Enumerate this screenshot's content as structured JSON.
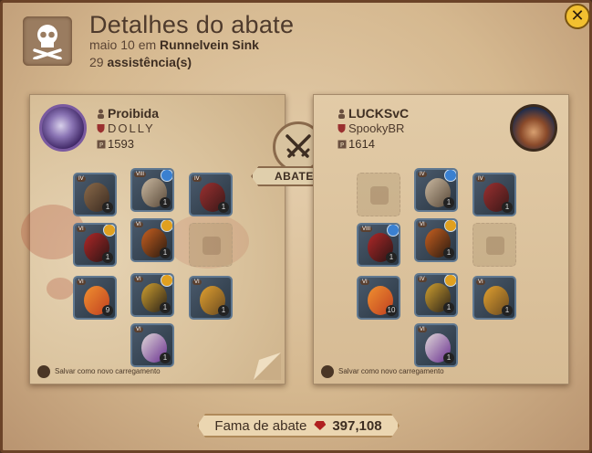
{
  "dialog": {
    "title": "Detalhes do abate",
    "date_text": "maio 10 em",
    "location": "Runnelvein Sink",
    "assist_count": "29",
    "assist_label": "assistência(s)"
  },
  "killer": {
    "name": "Proibida",
    "guild": "DOLLY",
    "ip": "1593",
    "equipment": [
      {
        "slot": "bag",
        "tier": "IV",
        "quality": "1",
        "badge": ""
      },
      {
        "slot": "helmet",
        "tier": "VIII",
        "quality": "1",
        "badge": "blue"
      },
      {
        "slot": "cape",
        "tier": "IV",
        "quality": "1",
        "badge": ""
      },
      {
        "slot": "weapon",
        "tier": "VI",
        "quality": "1",
        "badge": "gold"
      },
      {
        "slot": "armor",
        "tier": "VI",
        "quality": "1",
        "badge": "gold"
      },
      {
        "slot": "offhand",
        "tier": "",
        "quality": "",
        "badge": ""
      },
      {
        "slot": "potion",
        "tier": "VI",
        "quality": "9",
        "badge": ""
      },
      {
        "slot": "shoes",
        "tier": "VI",
        "quality": "1",
        "badge": "gold"
      },
      {
        "slot": "food",
        "tier": "VI",
        "quality": "1",
        "badge": ""
      },
      {
        "slot": "mount",
        "tier": "VI",
        "quality": "1",
        "badge": ""
      }
    ],
    "save_label": "Salvar como novo carregamento"
  },
  "victim": {
    "name": "LUCKSvC",
    "guild": "SpookyBR",
    "ip": "1614",
    "equipment": [
      {
        "slot": "bag",
        "tier": "",
        "quality": "",
        "badge": ""
      },
      {
        "slot": "helmet",
        "tier": "IV",
        "quality": "1",
        "badge": "blue"
      },
      {
        "slot": "cape",
        "tier": "IV",
        "quality": "1",
        "badge": ""
      },
      {
        "slot": "weapon",
        "tier": "VIII",
        "quality": "1",
        "badge": "blue"
      },
      {
        "slot": "armor",
        "tier": "VI",
        "quality": "1",
        "badge": "gold"
      },
      {
        "slot": "offhand",
        "tier": "",
        "quality": "",
        "badge": ""
      },
      {
        "slot": "potion",
        "tier": "VI",
        "quality": "10",
        "badge": ""
      },
      {
        "slot": "shoes",
        "tier": "IV",
        "quality": "1",
        "badge": "gold"
      },
      {
        "slot": "food",
        "tier": "VI",
        "quality": "1",
        "badge": ""
      },
      {
        "slot": "mount",
        "tier": "VI",
        "quality": "1",
        "badge": ""
      }
    ],
    "save_label": "Salvar como novo carregamento"
  },
  "killed_label": "ABATEU",
  "fame": {
    "label": "Fama de abate",
    "value": "397,108"
  },
  "colors": {
    "accent_gold": "#f2c030",
    "fame_gem": "#b02020",
    "parchment": "#d5b88f"
  }
}
